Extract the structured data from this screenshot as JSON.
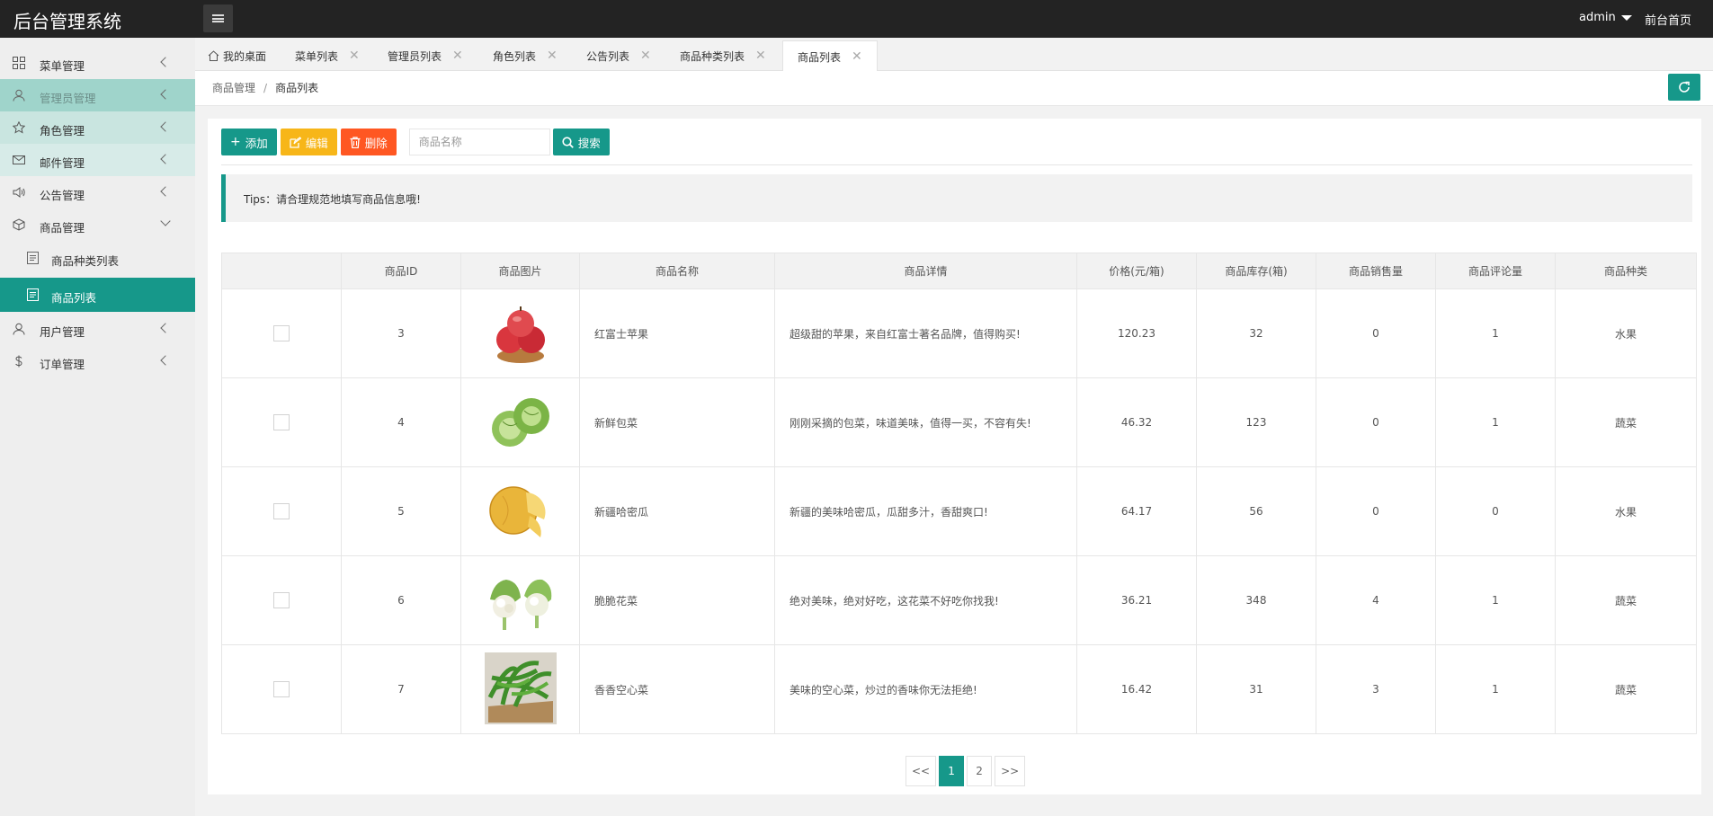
{
  "app": {
    "title": "后台管理系统",
    "user": "admin",
    "home_link": "前台首页"
  },
  "sidebar": {
    "items": [
      {
        "label": "菜单管理",
        "icon": "grid-icon"
      },
      {
        "label": "管理员管理",
        "icon": "user-icon"
      },
      {
        "label": "角色管理",
        "icon": "star-icon"
      },
      {
        "label": "邮件管理",
        "icon": "mail-icon"
      },
      {
        "label": "公告管理",
        "icon": "speaker-icon"
      },
      {
        "label": "商品管理",
        "icon": "cube-icon"
      },
      {
        "label": "用户管理",
        "icon": "user-icon"
      },
      {
        "label": "订单管理",
        "icon": "dollar-icon"
      }
    ],
    "subitems": [
      {
        "label": "商品种类列表",
        "icon": "doc-icon"
      },
      {
        "label": "商品列表",
        "icon": "doc-icon"
      }
    ]
  },
  "tabs": [
    {
      "label": "我的桌面"
    },
    {
      "label": "菜单列表"
    },
    {
      "label": "管理员列表"
    },
    {
      "label": "角色列表"
    },
    {
      "label": "公告列表"
    },
    {
      "label": "商品种类列表"
    },
    {
      "label": "商品列表"
    }
  ],
  "breadcrumb": {
    "parent": "商品管理",
    "separator": "/",
    "current": "商品列表"
  },
  "toolbar": {
    "add_label": "添加",
    "edit_label": "编辑",
    "delete_label": "删除",
    "search_placeholder": "商品名称",
    "search_label": "搜索"
  },
  "tips": "Tips：请合理规范地填写商品信息哦!",
  "table": {
    "headers": [
      "",
      "商品ID",
      "商品图片",
      "商品名称",
      "商品详情",
      "价格(元/箱)",
      "商品库存(箱)",
      "商品销售量",
      "商品评论量",
      "商品种类"
    ],
    "rows": [
      {
        "id": "3",
        "image": "apple",
        "name": "红富士苹果",
        "detail": "超级甜的苹果，来自红富士著名品牌，值得购买!",
        "price": "120.23",
        "stock": "32",
        "sales": "0",
        "comments": "1",
        "category": "水果"
      },
      {
        "id": "4",
        "image": "cabbage",
        "name": "新鲜包菜",
        "detail": "刚刚采摘的包菜，味道美味，值得一买，不容有失!",
        "price": "46.32",
        "stock": "123",
        "sales": "0",
        "comments": "1",
        "category": "蔬菜"
      },
      {
        "id": "5",
        "image": "melon",
        "name": "新疆哈密瓜",
        "detail": "新疆的美味哈密瓜，瓜甜多汁，香甜爽口!",
        "price": "64.17",
        "stock": "56",
        "sales": "0",
        "comments": "0",
        "category": "水果"
      },
      {
        "id": "6",
        "image": "cauliflower",
        "name": "脆脆花菜",
        "detail": "绝对美味，绝对好吃，这花菜不好吃你找我!",
        "price": "36.21",
        "stock": "348",
        "sales": "4",
        "comments": "1",
        "category": "蔬菜"
      },
      {
        "id": "7",
        "image": "water-spinach",
        "name": "香香空心菜",
        "detail": "美味的空心菜，炒过的香味你无法拒绝!",
        "price": "16.42",
        "stock": "31",
        "sales": "3",
        "comments": "1",
        "category": "蔬菜"
      }
    ]
  },
  "pagination": {
    "prev": "<<",
    "pages": [
      "1",
      "2"
    ],
    "current": "1",
    "next": ">>"
  },
  "colors": {
    "accent": "#16988a",
    "edit": "#f7b619",
    "delete": "#ff5722",
    "header": "#232323"
  }
}
